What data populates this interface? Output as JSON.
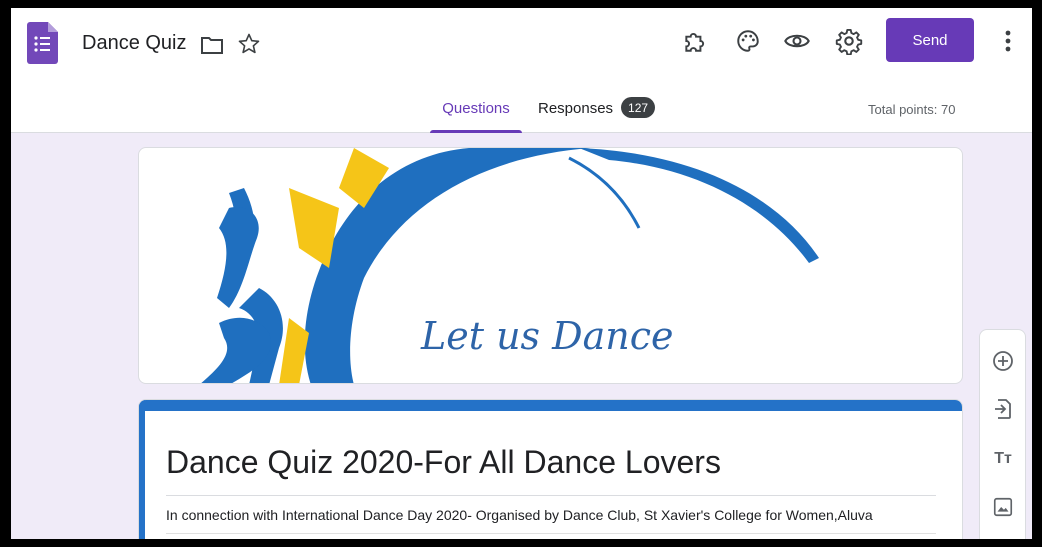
{
  "header": {
    "doc_title": "Dance Quiz",
    "send_label": "Send",
    "icons": [
      "forms-logo-icon",
      "folder-icon",
      "star-icon",
      "addon-icon",
      "palette-icon",
      "preview-eye-icon",
      "settings-gear-icon",
      "more-vert-icon"
    ]
  },
  "tabs": {
    "questions_label": "Questions",
    "responses_label": "Responses",
    "responses_count": "127",
    "total_points": "Total points: 70"
  },
  "banner": {
    "text": "Let us Dance"
  },
  "form": {
    "title": "Dance Quiz 2020-For All Dance Lovers",
    "description": "In connection with International Dance Day 2020- Organised by Dance Club, St Xavier's College for Women,Aluva"
  },
  "toolbar": {
    "title_tool_label": "Tт",
    "icons": [
      "add-question-icon",
      "import-questions-icon",
      "add-title-icon",
      "add-image-icon"
    ]
  },
  "colors": {
    "accent": "#673ab7",
    "theme_blue": "#2472c8",
    "background": "#f0ebf8"
  }
}
